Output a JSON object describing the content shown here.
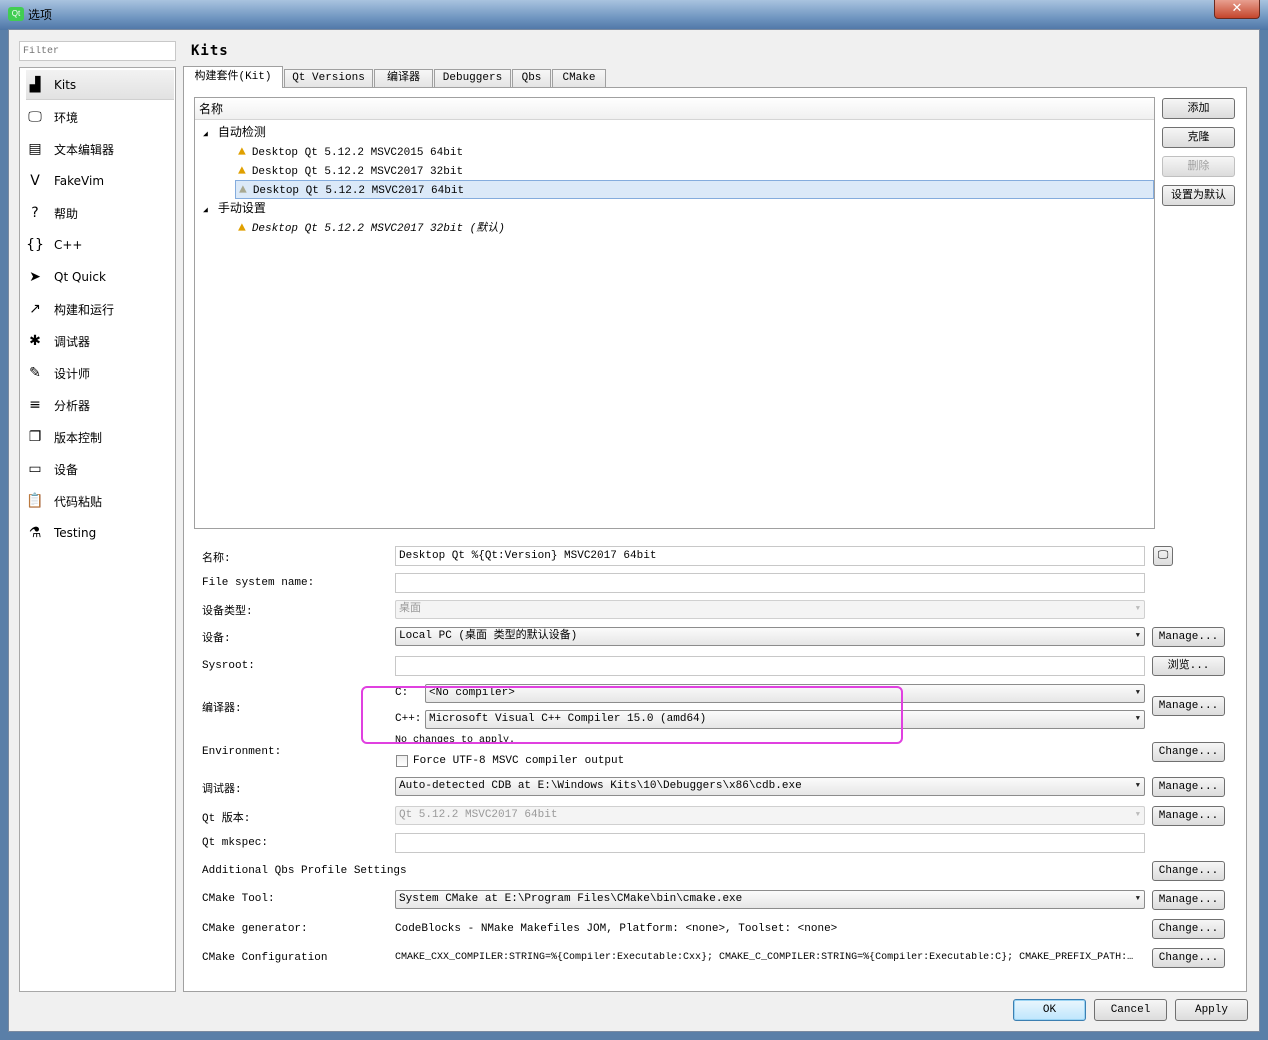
{
  "window": {
    "title": "选项",
    "close_icon": "close-icon"
  },
  "filter": {
    "placeholder": "Filter"
  },
  "sidebar": {
    "items": [
      {
        "label": "Kits",
        "icon": "kits-icon"
      },
      {
        "label": "环境",
        "icon": "monitor-icon"
      },
      {
        "label": "文本编辑器",
        "icon": "text-editor-icon"
      },
      {
        "label": "FakeVim",
        "icon": "fakevim-icon"
      },
      {
        "label": "帮助",
        "icon": "help-icon"
      },
      {
        "label": "C++",
        "icon": "braces-icon"
      },
      {
        "label": "Qt Quick",
        "icon": "qtquick-icon"
      },
      {
        "label": "构建和运行",
        "icon": "hammer-icon"
      },
      {
        "label": "调试器",
        "icon": "bug-icon"
      },
      {
        "label": "设计师",
        "icon": "pencil-icon"
      },
      {
        "label": "分析器",
        "icon": "analyzer-icon"
      },
      {
        "label": "版本控制",
        "icon": "version-control-icon"
      },
      {
        "label": "设备",
        "icon": "device-icon"
      },
      {
        "label": "代码粘贴",
        "icon": "clipboard-icon"
      },
      {
        "label": "Testing",
        "icon": "testing-icon"
      }
    ]
  },
  "page_title": "Kits",
  "tabs": [
    "构建套件(Kit)",
    "Qt Versions",
    "编译器",
    "Debuggers",
    "Qbs",
    "CMake"
  ],
  "tree": {
    "header": "名称",
    "groups": [
      {
        "label": "自动检测",
        "items": [
          "Desktop Qt 5.12.2 MSVC2015 64bit",
          "Desktop Qt 5.12.2 MSVC2017 32bit",
          "Desktop Qt 5.12.2 MSVC2017 64bit"
        ]
      },
      {
        "label": "手动设置",
        "items": [
          "Desktop Qt 5.12.2 MSVC2017 32bit (默认)"
        ]
      }
    ]
  },
  "kit_buttons": {
    "add": "添加",
    "clone": "克隆",
    "remove": "删除",
    "default": "设置为默认"
  },
  "form": {
    "name_label": "名称:",
    "name_value": "Desktop Qt %{Qt:Version} MSVC2017 64bit",
    "fsname_label": "File system name:",
    "fsname_value": "",
    "devtype_label": "设备类型:",
    "devtype_value": "桌面",
    "device_label": "设备:",
    "device_value": "Local PC (桌面 类型的默认设备)",
    "sysroot_label": "Sysroot:",
    "sysroot_value": "",
    "compiler_label": "编译器:",
    "c_label": "C:",
    "c_value": "<No compiler>",
    "cxx_label": "C++:",
    "cxx_value": "Microsoft Visual C++ Compiler 15.0 (amd64)",
    "no_changes": "No changes to apply.",
    "env_label": "Environment:",
    "force_utf8": "Force UTF-8 MSVC compiler output",
    "force_utf8_checked": false,
    "debugger_label": "调试器:",
    "debugger_value": "Auto-detected CDB at E:\\Windows Kits\\10\\Debuggers\\x86\\cdb.exe",
    "qtver_label": "Qt 版本:",
    "qtver_value": "Qt 5.12.2 MSVC2017 64bit",
    "mkspec_label": "Qt mkspec:",
    "mkspec_value": "",
    "qbs_label": "Additional Qbs Profile Settings",
    "cmaketool_label": "CMake Tool:",
    "cmaketool_value": "System CMake at E:\\Program Files\\CMake\\bin\\cmake.exe",
    "cmakegen_label": "CMake generator:",
    "cmakegen_value": "CodeBlocks - NMake Makefiles JOM, Platform: <none>, Toolset: <none>",
    "cmakecfg_label": "CMake Configuration",
    "cmakecfg_value": "CMAKE_CXX_COMPILER:STRING=%{Compiler:Executable:Cxx}; CMAKE_C_COMPILER:STRING=%{Compiler:Executable:C}; CMAKE_PREFIX_PATH:…",
    "manage": "Manage...",
    "browse": "浏览...",
    "change": "Change..."
  },
  "dialog": {
    "ok": "OK",
    "cancel": "Cancel",
    "apply": "Apply"
  },
  "colors": {
    "annotation": "#e040e0",
    "selection": "#dbe9f8"
  }
}
